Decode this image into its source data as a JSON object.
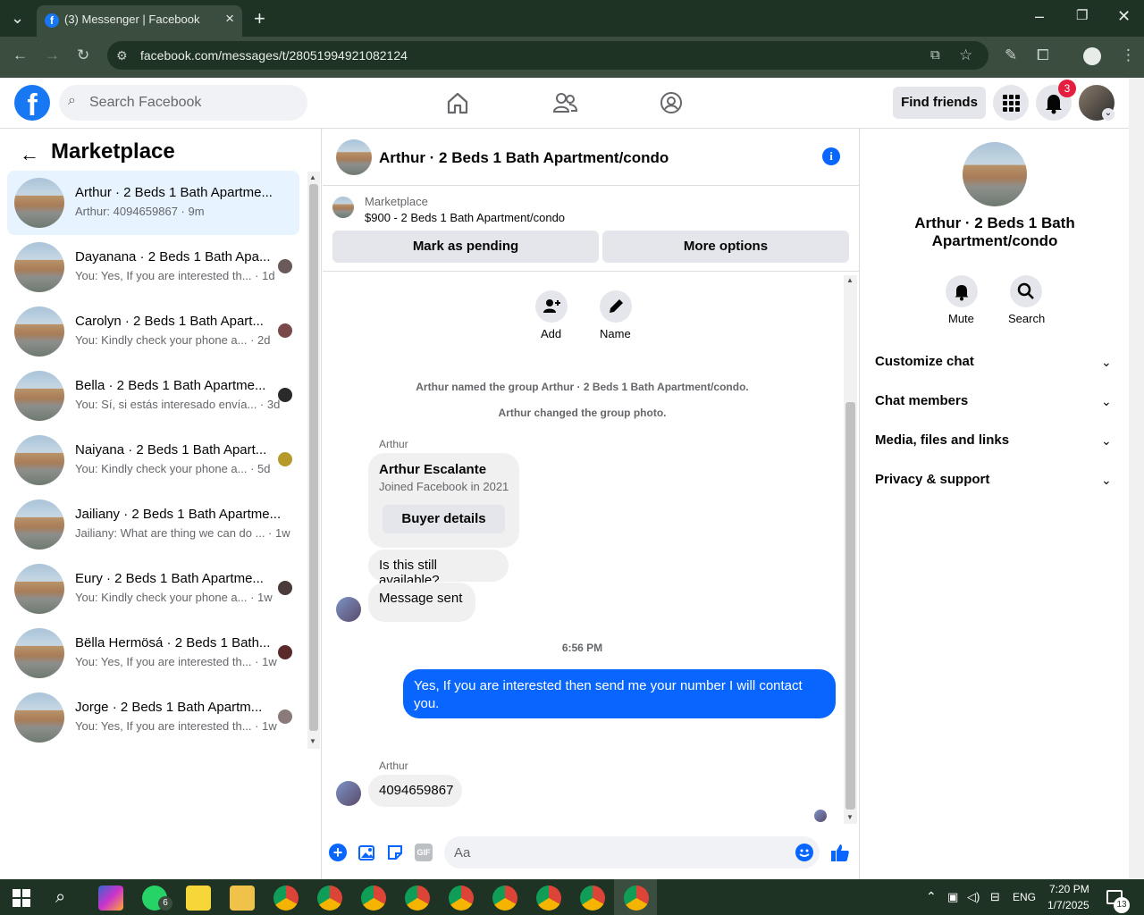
{
  "browser": {
    "tab_title": "(3) Messenger | Facebook",
    "url": "facebook.com/messages/t/28051994921082124"
  },
  "fb_header": {
    "search_placeholder": "Search Facebook",
    "find_friends": "Find friends",
    "notification_count": "3"
  },
  "left_panel": {
    "title": "Marketplace",
    "conversations": [
      {
        "name": "Arthur · 2 Beds 1 Bath Apartme...",
        "preview": "Arthur: 4094659867 · 9m"
      },
      {
        "name": "Dayanana · 2 Beds 1 Bath Apa...",
        "preview": "You: Yes, If you are interested th... · 1d"
      },
      {
        "name": "Carolyn · 2 Beds 1 Bath Apart...",
        "preview": "You: Kindly check your phone a... · 2d"
      },
      {
        "name": "Bella · 2 Beds 1 Bath Apartme...",
        "preview": "You: Sí, si estás interesado envía... · 3d"
      },
      {
        "name": "Naiyana · 2 Beds 1 Bath Apart...",
        "preview": "You: Kindly check your phone a... · 5d"
      },
      {
        "name": "Jailiany · 2 Beds 1 Bath Apartme...",
        "preview": "Jailiany: What are thing we can do ... · 1w"
      },
      {
        "name": "Eury · 2 Beds 1 Bath Apartme...",
        "preview": "You: Kindly check your phone a... · 1w"
      },
      {
        "name": "Bëlla Hermösá · 2 Beds 1 Bath...",
        "preview": "You: Yes, If you are interested th... · 1w"
      },
      {
        "name": "Jorge · 2 Beds 1 Bath Apartm...",
        "preview": "You: Yes, If you are interested th... · 1w"
      }
    ]
  },
  "chat": {
    "title": "Arthur · 2 Beds 1 Bath Apartment/condo",
    "marketplace_label": "Marketplace",
    "listing": "$900 - 2 Beds 1 Bath Apartment/condo",
    "mark_pending": "Mark as pending",
    "more_options": "More options",
    "add_label": "Add",
    "name_label": "Name",
    "system_1": "Arthur named the group Arthur · 2 Beds 1 Bath Apartment/condo.",
    "system_2": "Arthur changed the group photo.",
    "sender_1": "Arthur",
    "card_name": "Arthur Escalante",
    "card_sub": "Joined Facebook in 2021",
    "buyer_details": "Buyer details",
    "msg_available": "Is this still available?",
    "msg_sent": "Message sent",
    "time": "6:56 PM",
    "my_msg": "Yes, If you are interested then send me your number I will contact you.",
    "sender_2": "Arthur",
    "msg_number": "4094659867",
    "composer_placeholder": "Aa",
    "gif": "GIF"
  },
  "right_panel": {
    "title": "Arthur · 2 Beds 1 Bath Apartment/condo",
    "mute": "Mute",
    "search": "Search",
    "sections": [
      "Customize chat",
      "Chat members",
      "Media, files and links",
      "Privacy & support"
    ]
  },
  "taskbar": {
    "whatsapp_badge": "6",
    "lang": "ENG",
    "time": "7:20 PM",
    "date": "1/7/2025",
    "notif": "13"
  }
}
